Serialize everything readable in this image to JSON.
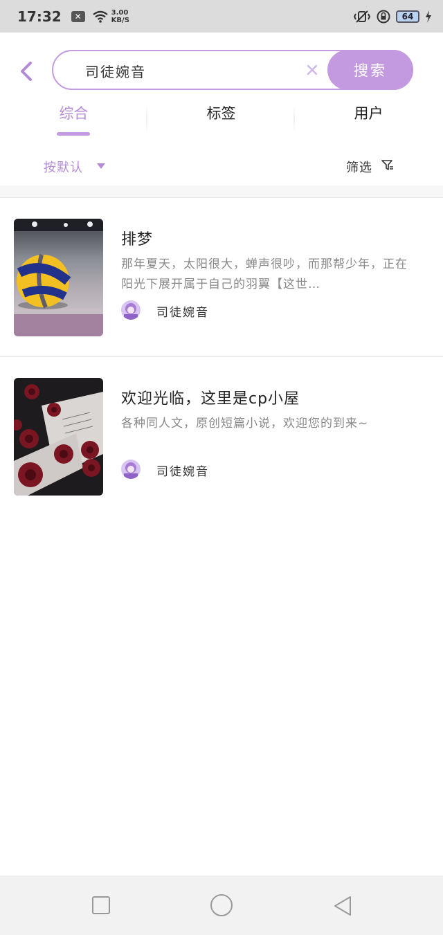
{
  "status_bar": {
    "time": "17:32",
    "notification_icon": "close-box-icon",
    "net_speed_value": "3.00",
    "net_speed_unit": "KB/S",
    "battery": "64"
  },
  "search": {
    "value": "司徒婉音",
    "button_label": "搜索"
  },
  "tabs": [
    {
      "label": "综合",
      "active": true
    },
    {
      "label": "标签",
      "active": false
    },
    {
      "label": "用户",
      "active": false
    }
  ],
  "filters": {
    "sort_label": "按默认",
    "filter_label": "筛选"
  },
  "results": [
    {
      "title": "排梦",
      "description": "那年夏天，太阳很大，蝉声很吵，而那帮少年，正在阳光下展开属于自己的羽翼【这世…",
      "author": "司徒婉音",
      "cover": "volleyball-cover"
    },
    {
      "title": "欢迎光临，这里是cp小屋",
      "description": "各种同人文，原创短篇小说，欢迎您的到来~",
      "author": "司徒婉音",
      "cover": "roses-cover"
    }
  ],
  "colors": {
    "accent": "#c39ae0",
    "accent_text": "#b38bd5",
    "status_bar": "#dcdcdc"
  }
}
